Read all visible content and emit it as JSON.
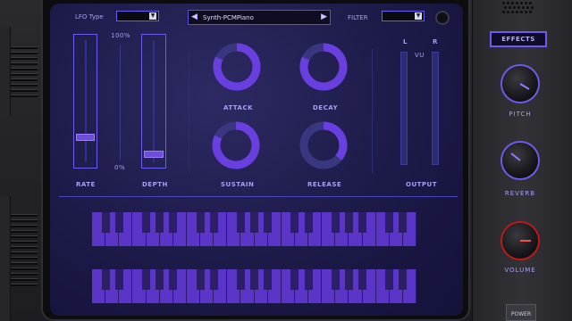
{
  "header": {
    "lfo_type_label": "LFO Type",
    "lfo_type_value": "",
    "preset_name": "Synth-PCMPiano",
    "prev_symbol": "◀",
    "next_symbol": "▶",
    "filter_label": "FILTER",
    "filter_value": ""
  },
  "sliders": {
    "rate_label": "RATE",
    "depth_label": "DEPTH",
    "scale_top": "100%",
    "scale_bottom": "0%",
    "rate_value": 0.22,
    "depth_value": 0.08
  },
  "envelope": {
    "attack": {
      "label": "ATTACK",
      "value": 0.82
    },
    "decay": {
      "label": "DECAY",
      "value": 0.82
    },
    "sustain": {
      "label": "SUSTAIN",
      "value": 0.82
    },
    "release": {
      "label": "RELEASE",
      "value": 0.36
    }
  },
  "output": {
    "label": "OUTPUT",
    "left_label": "L",
    "right_label": "R",
    "vu_label": "VU"
  },
  "right_panel": {
    "effects_label": "EFFECTS",
    "pitch_label": "PITCH",
    "reverb_label": "REVERB",
    "volume_label": "VOLUME",
    "power_label": "POWER"
  },
  "colors": {
    "accent": "#6b5cf0",
    "knob_fill": "#6a3fe0",
    "knob_track": "#3a3780",
    "volume_ring": "#c01818"
  }
}
